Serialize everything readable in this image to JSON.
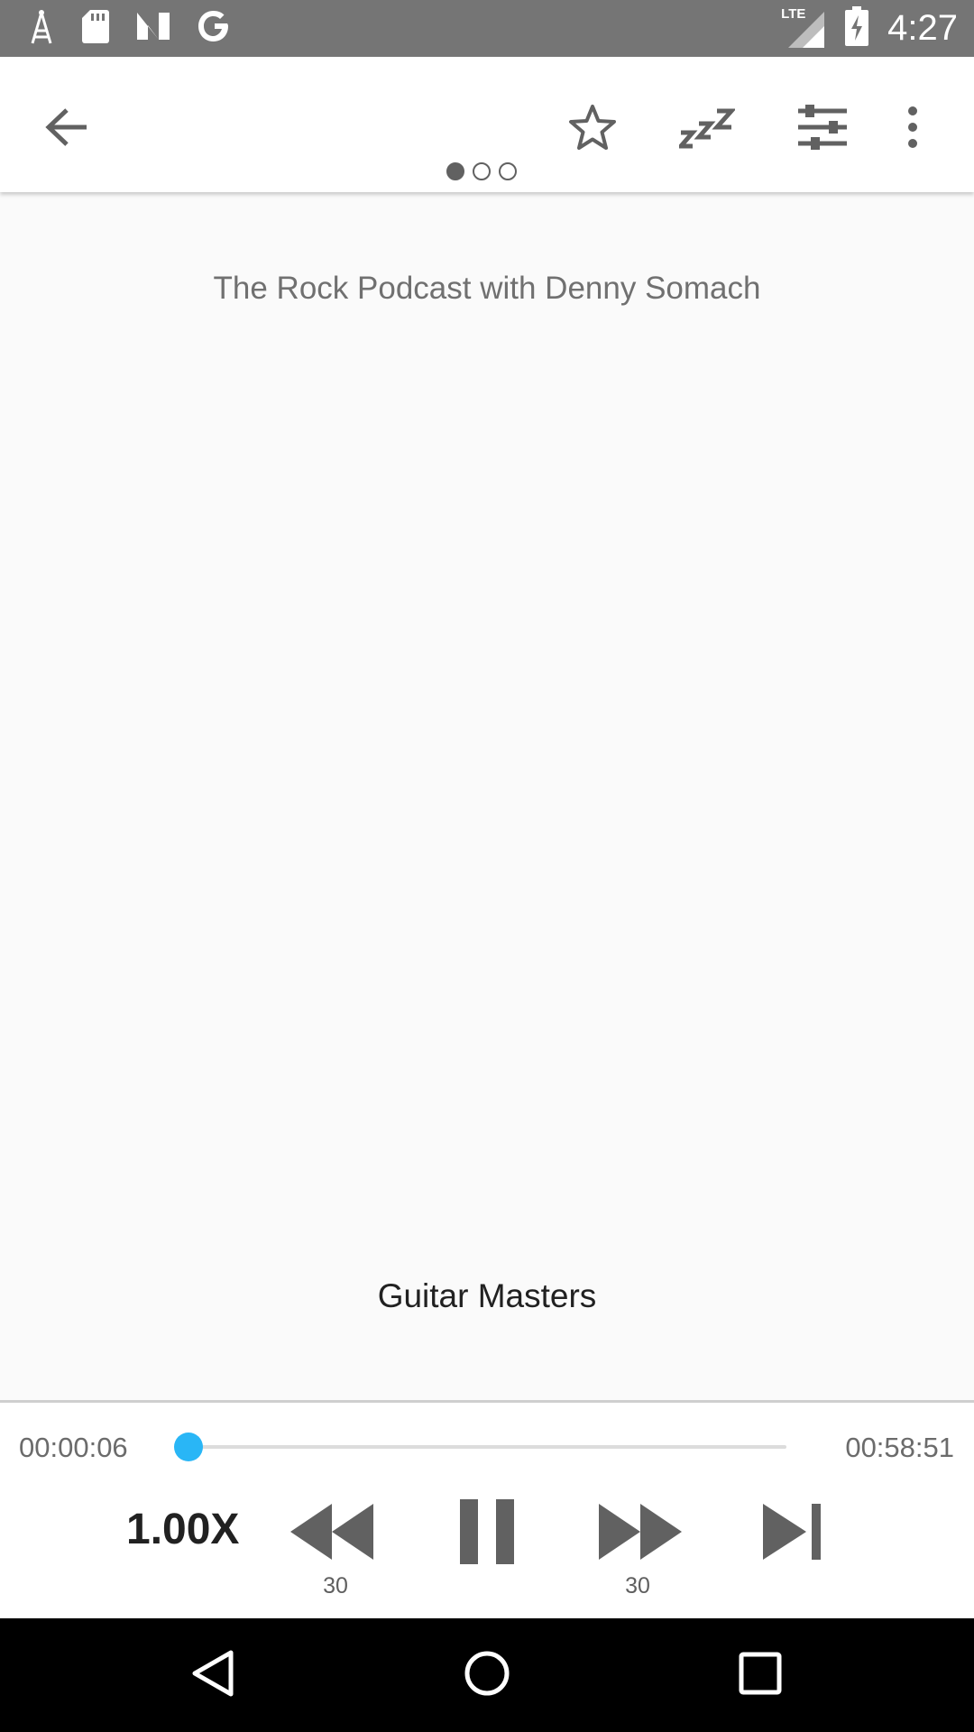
{
  "status_bar": {
    "time": "4:27",
    "network": "LTE",
    "icons": [
      "signal-tower-icon",
      "sd-card-icon",
      "n-logo-icon",
      "google-icon",
      "lte-signal-icon",
      "battery-charging-icon"
    ]
  },
  "toolbar": {
    "back_icon": "arrow-back-icon",
    "actions": [
      "star-icon",
      "sleep-timer-icon",
      "equalizer-icon",
      "more-vert-icon"
    ],
    "page_count": 3,
    "active_page": 1
  },
  "content": {
    "podcast_title": "The Rock Podcast with Denny Somach",
    "episode_title": "Guitar Masters"
  },
  "player": {
    "elapsed": "00:00:06",
    "total": "00:58:51",
    "progress_fraction": 0.0017,
    "speed": "1.00X",
    "rewind_seconds": "30",
    "forward_seconds": "30",
    "accent_color": "#29b6f6"
  },
  "nav_bar": {
    "buttons": [
      "back-triangle-icon",
      "home-circle-icon",
      "recents-square-icon"
    ]
  }
}
